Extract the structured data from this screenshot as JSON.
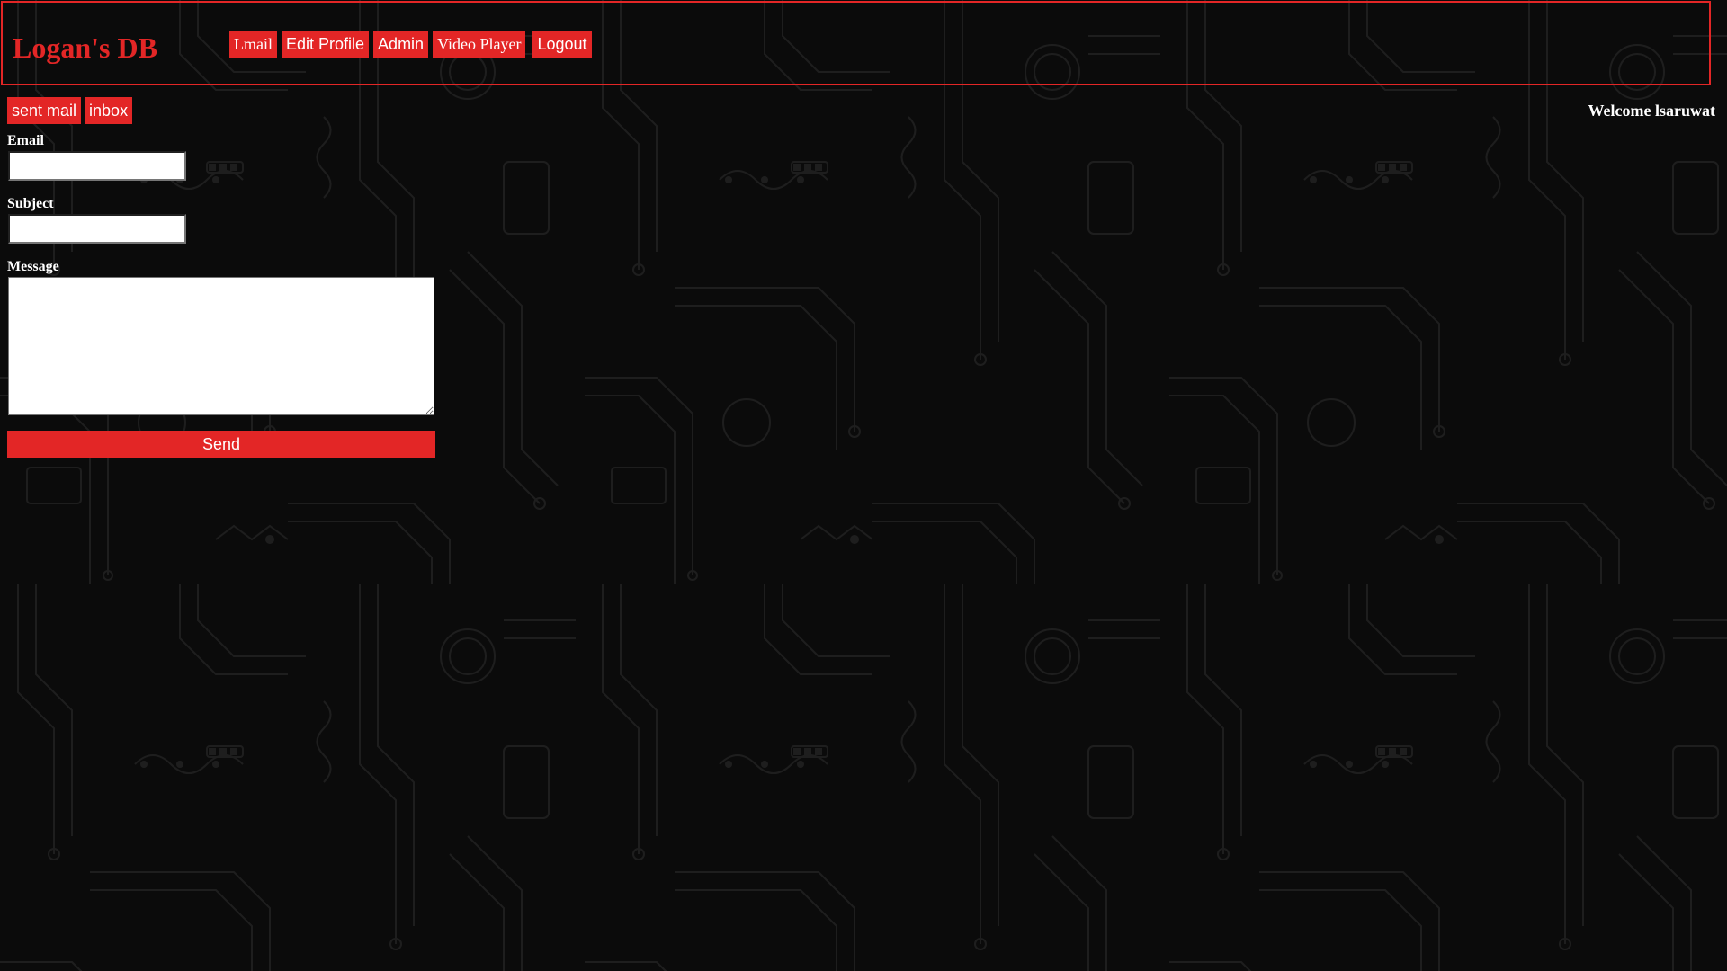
{
  "header": {
    "title": "Logan's DB",
    "nav": [
      {
        "label": "Lmail"
      },
      {
        "label": "Edit Profile"
      },
      {
        "label": "Admin"
      },
      {
        "label": "Video Player"
      },
      {
        "label": "Logout"
      }
    ]
  },
  "mail": {
    "tabs": [
      {
        "label": "sent mail"
      },
      {
        "label": "inbox"
      }
    ]
  },
  "welcome": {
    "prefix": "Welcome ",
    "username": "lsaruwat"
  },
  "form": {
    "email_label": "Email",
    "email_value": "",
    "subject_label": "Subject",
    "subject_value": "",
    "message_label": "Message",
    "message_value": "",
    "send_label": "Send"
  },
  "colors": {
    "accent": "#e32626",
    "background": "#0b0b0b",
    "circuit": "#1f1f1f"
  }
}
